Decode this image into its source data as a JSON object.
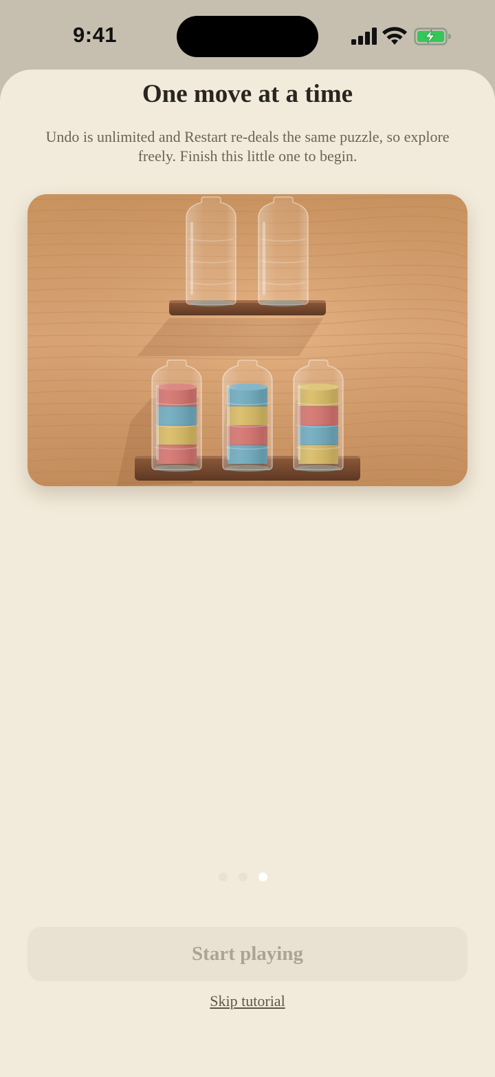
{
  "status_bar": {
    "time": "9:41",
    "icons": [
      "signal-icon",
      "wifi-icon",
      "battery-charging-icon"
    ],
    "battery_color": "#34c759"
  },
  "tutorial": {
    "title": "One move at a time",
    "subtitle": "Undo is unlimited and Restart re-deals the same puzzle, so explore freely. Finish this little one to begin.",
    "page_count": 3,
    "current_page": 3
  },
  "puzzle": {
    "colors": {
      "red": "#d0605a",
      "yellow": "#d5b24f",
      "blue": "#5b9fb6"
    },
    "top_shelf_bottles": [
      [],
      []
    ],
    "bottom_shelf_bottles": [
      [
        "red",
        "yellow",
        "blue",
        "red"
      ],
      [
        "blue",
        "red",
        "yellow",
        "blue"
      ],
      [
        "yellow",
        "blue",
        "red",
        "yellow"
      ]
    ]
  },
  "actions": {
    "start_label": "Start playing",
    "skip_label": "Skip tutorial"
  }
}
